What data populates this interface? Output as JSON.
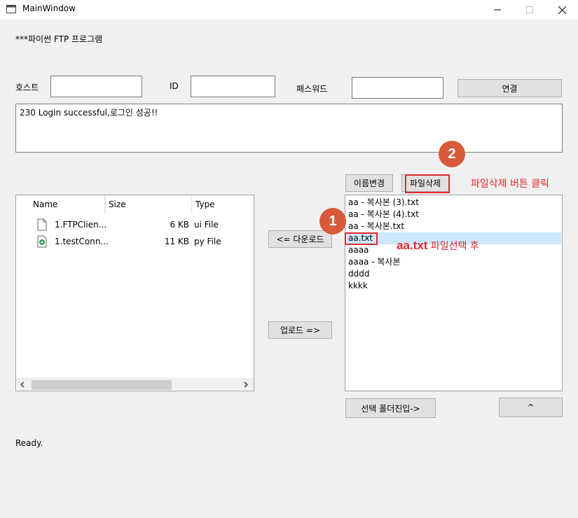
{
  "window": {
    "title": "MainWindow"
  },
  "header": {
    "program_title": "***파이썬 FTP 프로그램"
  },
  "connection": {
    "host_label": "호스트",
    "id_label": "ID",
    "password_label": "패스워드",
    "host_value": "",
    "id_value": "",
    "password_value": "",
    "connect_label": "연결"
  },
  "log": {
    "text": "230 Login successful,로그인 성공!!"
  },
  "local_panel": {
    "columns": [
      "Name",
      "Size",
      "Type"
    ],
    "files": [
      {
        "name": "1.FTPClien...",
        "size": "6 KB",
        "type": "ui File",
        "icon": "document-icon"
      },
      {
        "name": "1.testConn...",
        "size": "11 KB",
        "type": "py File",
        "icon": "python-file-icon"
      }
    ]
  },
  "buttons": {
    "rename": "이름변경",
    "delete": "파일삭제",
    "download": "<= 다운로드",
    "upload": "업로드 =>",
    "enter_folder": "선택 폴더진입->",
    "up": "^"
  },
  "remote_panel": {
    "items": [
      "aa - 복사본 (3).txt",
      "aa - 복사본 (4).txt",
      "aa - 복사본.txt",
      "aa.txt",
      "aaaa",
      "aaaa - 복사본",
      "dddd",
      "kkkk"
    ],
    "selected_index": 3
  },
  "annotations": {
    "badge1": "1",
    "badge2": "2",
    "note_delete": "파일삭제 버튼 클릭",
    "note_select_file": "aa.txt",
    "note_select_rest": "파일선택 후"
  },
  "status": {
    "text": "Ready."
  },
  "colors": {
    "annotation_red": "#e0282f",
    "badge": "#d75a3a",
    "selection": "#cce8ff"
  }
}
